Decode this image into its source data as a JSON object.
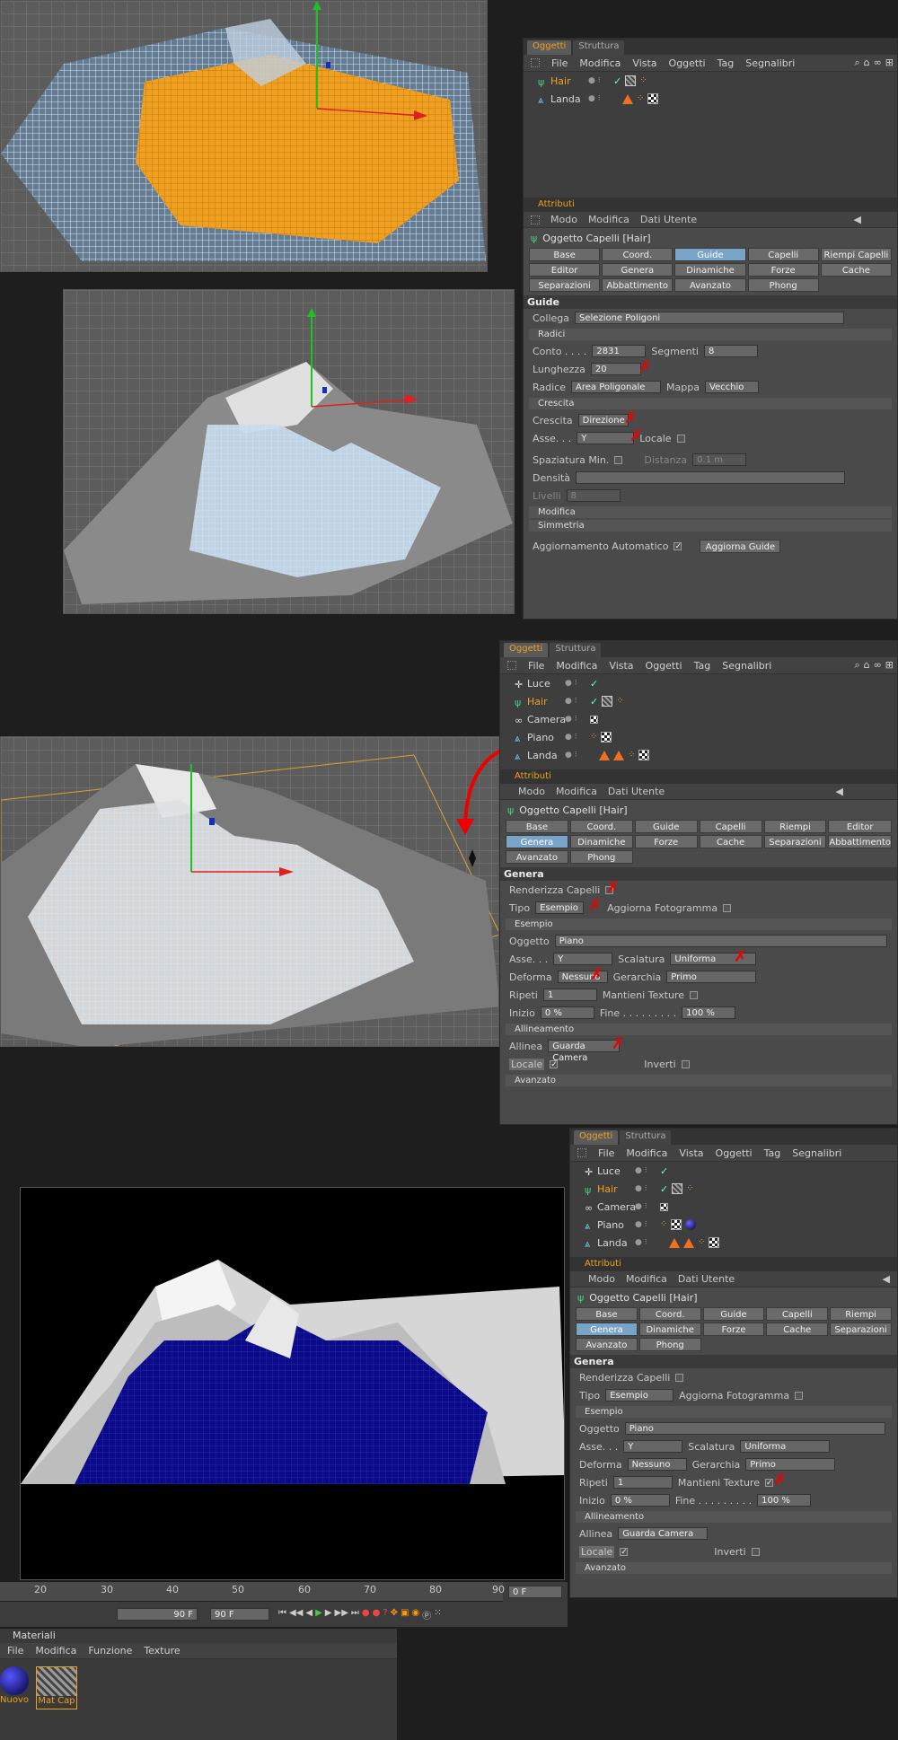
{
  "panel1": {
    "tabs": [
      "Oggetti",
      "Struttura"
    ],
    "menu": [
      "File",
      "Modifica",
      "Vista",
      "Oggetti",
      "Tag",
      "Segnalibri"
    ],
    "objects": [
      "Hair",
      "Landa"
    ],
    "attr_header": "Attributi",
    "attr_menu": [
      "Modo",
      "Modifica",
      "Dati Utente"
    ],
    "obj_title": "Oggetto Capelli [Hair]",
    "buttons": [
      "Base",
      "Coord.",
      "Guide",
      "Capelli",
      "Riempi Capelli",
      "Editor",
      "Genera",
      "Dinamiche",
      "Forze",
      "Cache",
      "Separazioni",
      "Abbattimento",
      "Avanzato",
      "Phong"
    ],
    "section": "Guide",
    "collega_label": "Collega",
    "collega_value": "Selezione Poligoni",
    "radici": "Radici",
    "conto_label": "Conto . . . .",
    "conto_value": "2831",
    "segmenti_label": "Segmenti",
    "segmenti_value": "8",
    "lunghezza_label": "Lunghezza",
    "lunghezza_value": "20",
    "radice_label": "Radice",
    "radice_value": "Area Poligonale",
    "mappa_label": "Mappa",
    "mappa_value": "Vecchio",
    "crescita_sub": "Crescita",
    "crescita_label": "Crescita",
    "crescita_value": "Direzione",
    "asse_label": "Asse. . .",
    "asse_value": "Y",
    "locale_label": "Locale",
    "spaziatura_label": "Spaziatura Min.",
    "distanza_label": "Distanza",
    "distanza_value": "0.1 m",
    "densita_label": "Densità",
    "livelli_label": "Livelli",
    "livelli_value": "8",
    "modifica": "Modifica",
    "simmetria": "Simmetria",
    "aggiorn_label": "Aggiornamento Automatico",
    "aggiorna_button": "Aggiorna Guide"
  },
  "panel2": {
    "tabs": [
      "Oggetti",
      "Struttura"
    ],
    "menu": [
      "File",
      "Modifica",
      "Vista",
      "Oggetti",
      "Tag",
      "Segnalibri"
    ],
    "objects": [
      "Luce",
      "Hair",
      "Camera",
      "Piano",
      "Landa"
    ],
    "attr_header": "Attributi",
    "attr_menu": [
      "Modo",
      "Modifica",
      "Dati Utente"
    ],
    "obj_title": "Oggetto Capelli [Hair]",
    "buttons": [
      "Base",
      "Coord.",
      "Guide",
      "Capelli",
      "Riempi Capelli",
      "Editor",
      "Genera",
      "Dinamiche",
      "Forze",
      "Cache",
      "Separazioni",
      "Abbattimento",
      "Avanzato",
      "Phong"
    ],
    "section": "Genera",
    "render_label": "Renderizza Capelli",
    "tipo_label": "Tipo",
    "tipo_value": "Esempio",
    "aggfot_label": "Aggiorna Fotogramma",
    "esempio_sub": "Esempio",
    "oggetto_label": "Oggetto",
    "oggetto_value": "Piano",
    "asse_label": "Asse. . .",
    "asse_value": "Y",
    "scalatura_label": "Scalatura",
    "scalatura_value": "Uniforma",
    "deforma_label": "Deforma",
    "deforma_value": "Nessuno",
    "gerarchia_label": "Gerarchia",
    "gerarchia_value": "Primo",
    "ripeti_label": "Ripeti",
    "ripeti_value": "1",
    "mantieni_label": "Mantieni Texture",
    "inizio_label": "Inizio",
    "inizio_value": "0 %",
    "fine_label": "Fine . . . . . . . . .",
    "fine_value": "100 %",
    "allineamento_sub": "Allineamento",
    "allinea_label": "Allinea",
    "allinea_value": "Guarda Camera",
    "locale_label": "Locale",
    "inverti_label": "Inverti",
    "avanzato": "Avanzato"
  },
  "panel3": {
    "tabs": [
      "Oggetti",
      "Struttura"
    ],
    "menu": [
      "File",
      "Modifica",
      "Vista",
      "Oggetti",
      "Tag",
      "Segnalibri"
    ],
    "objects": [
      "Luce",
      "Hair",
      "Camera",
      "Piano",
      "Landa"
    ],
    "attr_header": "Attributi",
    "attr_menu": [
      "Modo",
      "Modifica",
      "Dati Utente"
    ],
    "obj_title": "Oggetto Capelli [Hair]",
    "buttons": [
      "Base",
      "Coord.",
      "Guide",
      "Capelli",
      "Riempi Capelli",
      "Genera",
      "Dinamiche",
      "Forze",
      "Cache",
      "Separazioni",
      "Avanzato",
      "Phong"
    ],
    "section": "Genera",
    "render_label": "Renderizza Capelli",
    "tipo_label": "Tipo",
    "tipo_value": "Esempio",
    "aggfot_label": "Aggiorna Fotogramma",
    "esempio_sub": "Esempio",
    "oggetto_label": "Oggetto",
    "oggetto_value": "Piano",
    "asse_label": "Asse. . .",
    "asse_value": "Y",
    "scalatura_label": "Scalatura",
    "scalatura_value": "Uniforma",
    "deforma_label": "Deforma",
    "deforma_value": "Nessuno",
    "gerarchia_label": "Gerarchia",
    "gerarchia_value": "Primo",
    "ripeti_label": "Ripeti",
    "ripeti_value": "1",
    "mantieni_label": "Mantieni Texture",
    "inizio_label": "Inizio",
    "inizio_value": "0 %",
    "fine_label": "Fine . . . . . . . . .",
    "fine_value": "100 %",
    "allineamento_sub": "Allineamento",
    "allinea_label": "Allinea",
    "allinea_value": "Guarda Camera",
    "locale_label": "Locale",
    "inverti_label": "Inverti",
    "avanzato": "Avanzato"
  },
  "timeline": {
    "ticks": [
      "20",
      "30",
      "40",
      "50",
      "60",
      "70",
      "80",
      "90"
    ],
    "end_field": "90 F",
    "end_field2": "90 F",
    "frame_field": "0 F"
  },
  "materials": {
    "title": "Materiali",
    "menu": [
      "File",
      "Modifica",
      "Funzione",
      "Texture"
    ],
    "items": [
      "Nuovo",
      "Mat Cap"
    ]
  }
}
